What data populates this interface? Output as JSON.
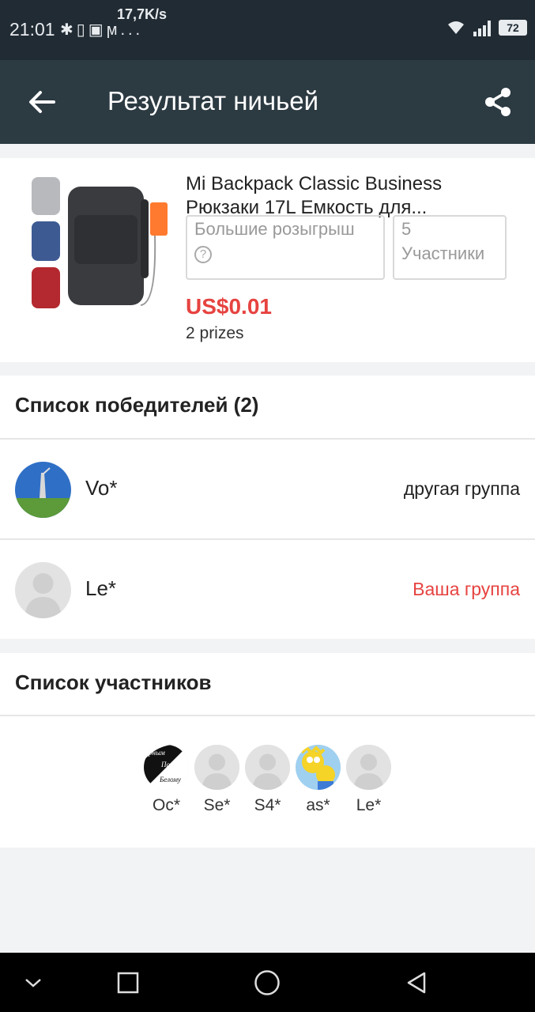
{
  "status_bar": {
    "time": "21:01",
    "net_speed": "17,7K/s",
    "icons": [
      "bluetooth-icon",
      "vibrate-icon",
      "app-icon",
      "app-icon",
      "more-dots-icon",
      "wifi-icon",
      "signal-3g-icon"
    ],
    "more": "...",
    "battery": "72"
  },
  "app_bar": {
    "title": "Результат ничьей",
    "back_icon": "arrow-left-icon",
    "share_icon": "share-icon"
  },
  "product": {
    "name": "Mi Backpack Classic Business Рюкзаки 17L Емкость для...",
    "draw_type": "Большие розыгрыш",
    "draw_type_help": "?",
    "participants_count": "5",
    "participants_label": "Участники",
    "price": "US$0.01",
    "prizes": "2 prizes"
  },
  "winners": {
    "heading": "Список победителей (2)",
    "items": [
      {
        "name": "Vo*",
        "group": "другая группа"
      },
      {
        "name": "Le*",
        "group": "Ваша группа"
      }
    ]
  },
  "participants": {
    "heading": "Список участников",
    "items": [
      {
        "name": "Oc*",
        "avatar_text_1": "ерным",
        "avatar_text_2": "По",
        "avatar_text_3": "Белому"
      },
      {
        "name": "Se*"
      },
      {
        "name": "S4*"
      },
      {
        "name": "as*"
      },
      {
        "name": "Le*"
      }
    ]
  },
  "colors": {
    "status_bar": "#212b33",
    "app_bar": "#2c3a42",
    "accent_red": "#e64340",
    "background": "#f2f3f5"
  },
  "nav_bar": {
    "icons": [
      "chevron-down-icon",
      "recents-square-icon",
      "home-circle-icon",
      "back-triangle-icon"
    ]
  }
}
